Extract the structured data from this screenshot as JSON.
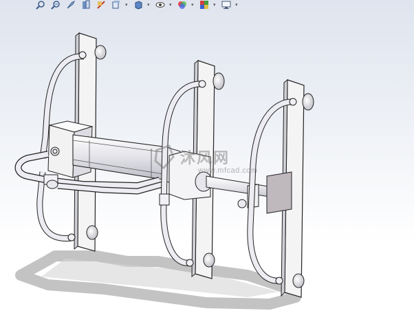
{
  "app": {
    "name": "SolidWorks 3D viewport"
  },
  "toolbar": {
    "buttons": [
      {
        "name": "zoom-to-fit-icon",
        "has_dropdown": false
      },
      {
        "name": "zoom-to-area-icon",
        "has_dropdown": false
      },
      {
        "name": "previous-view-icon",
        "has_dropdown": false
      },
      {
        "name": "section-view-icon",
        "has_dropdown": false
      },
      {
        "name": "dynamic-annotation-views-icon",
        "has_dropdown": false
      },
      {
        "name": "view-orientation-icon",
        "has_dropdown": true
      },
      {
        "name": "display-style-icon",
        "has_dropdown": true
      },
      {
        "name": "hide-show-items-icon",
        "has_dropdown": true
      },
      {
        "name": "edit-appearance-icon",
        "has_dropdown": true
      },
      {
        "name": "apply-scene-icon",
        "has_dropdown": true
      },
      {
        "name": "view-settings-icon",
        "has_dropdown": true
      }
    ]
  },
  "watermark": {
    "logo_text": "沐风网",
    "url_text": "www.mfcad.com"
  },
  "colors": {
    "background_top": "#dfe4ee",
    "background_bottom": "#ffffff",
    "part_fill": "#f4f4f4",
    "part_edge": "#222222",
    "tube": "#ececf2",
    "plate": "#bfb8bd",
    "shadow": "#b9b9b9"
  }
}
